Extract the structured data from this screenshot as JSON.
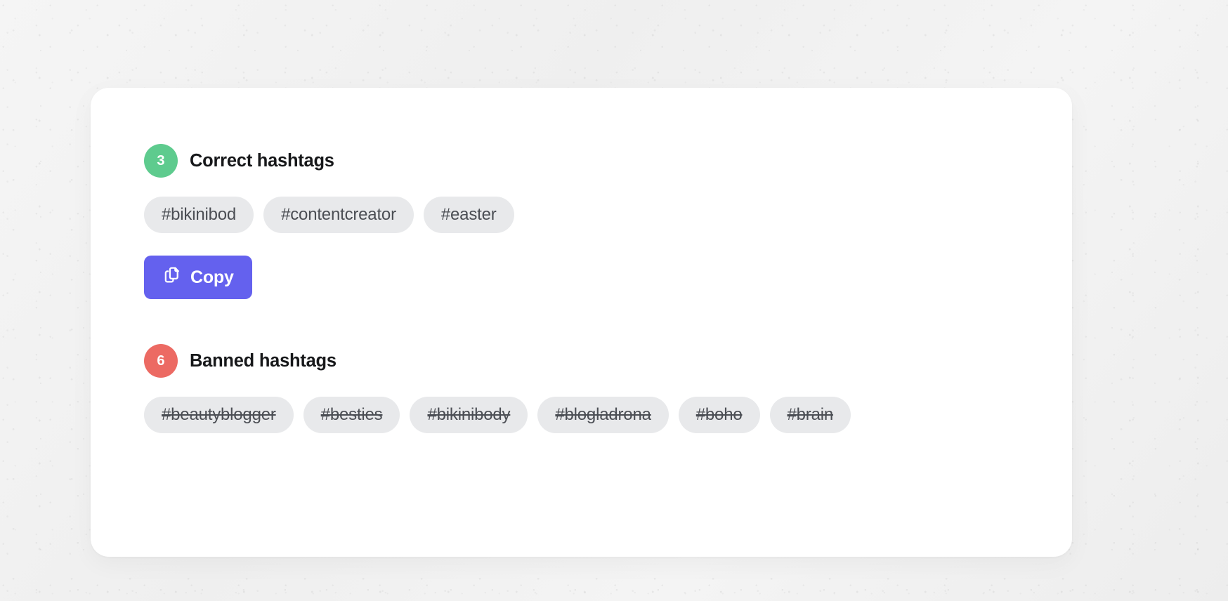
{
  "card": {
    "sections": [
      {
        "id": "correct-hashtags",
        "count": "3",
        "title": "Correct hashtags",
        "badge_color": "#5ecb8e",
        "state": "correct",
        "hashtags": [
          "#bikinibod",
          "#contentcreator",
          "#easter"
        ],
        "action": {
          "label": "Copy",
          "icon": "copy-icon",
          "color": "#6461ee"
        }
      },
      {
        "id": "banned-hashtags",
        "count": "6",
        "title": "Banned hashtags",
        "badge_color": "#ec6a63",
        "state": "banned",
        "hashtags": [
          "#beautyblogger",
          "#besties",
          "#bikinibody",
          "#blogladrona",
          "#boho",
          "#brain"
        ]
      }
    ]
  },
  "colors": {
    "pill_background": "#e8e9eb",
    "pill_text": "#4b4e54",
    "card_background": "#ffffff",
    "page_background": "#f2f2f2",
    "accent": "#6461ee"
  }
}
